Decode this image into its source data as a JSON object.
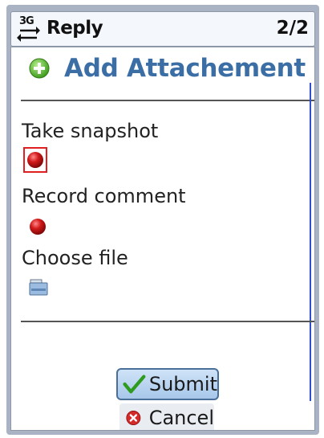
{
  "status": {
    "network_icon": "3g-arrows-icon",
    "network_label": "3G"
  },
  "titlebar": {
    "title": "Reply",
    "page_count": "2/2"
  },
  "header": {
    "title": "Add Attachement",
    "icon": "plus-circle-icon"
  },
  "options": {
    "snapshot_label": "Take snapshot",
    "comment_label": "Record comment",
    "file_label": "Choose file"
  },
  "buttons": {
    "submit_label": "Submit",
    "cancel_label": "Cancel"
  },
  "colors": {
    "accent": "#3b6ea5",
    "record": "#c81414",
    "focus": "#e02020"
  }
}
